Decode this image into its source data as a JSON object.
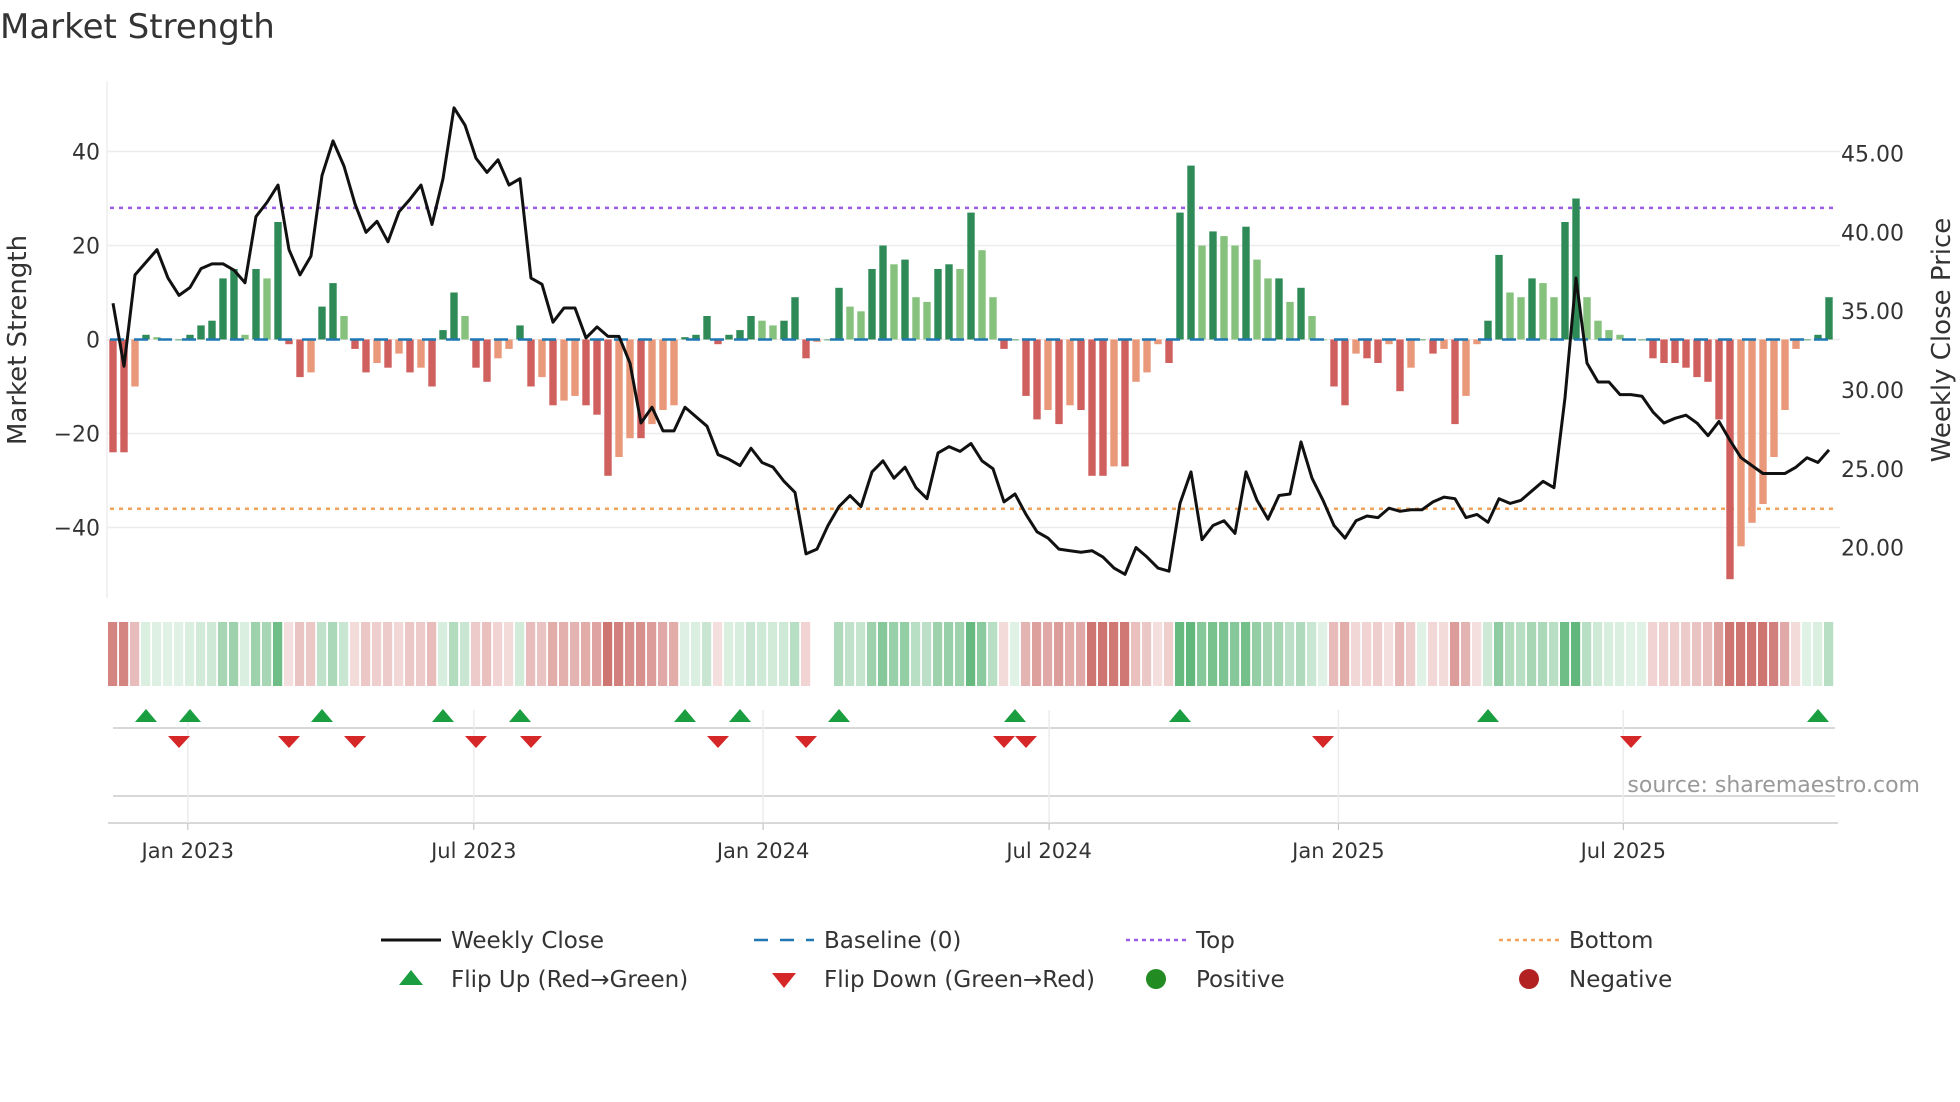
{
  "chart_data": {
    "type": "bar+line",
    "title": "Market Strength",
    "ylabel_left": "Market Strength",
    "ylabel_right": "Weekly Close Price",
    "ylim_left": [
      -55,
      55
    ],
    "ylim_right": [
      16.8,
      49.6
    ],
    "left_ticks": [
      40,
      20,
      0,
      -20,
      -40
    ],
    "left_tick_labels": [
      "40",
      "20",
      "0",
      "−20",
      "−40"
    ],
    "right_ticks": [
      45,
      40,
      35,
      30,
      25,
      20
    ],
    "right_tick_labels": [
      "45.00",
      "40.00",
      "35.00",
      "30.00",
      "25.00",
      "20.00"
    ],
    "x_tick_labels": [
      "Jan 2023",
      "Jul 2023",
      "Jan 2024",
      "Jul 2024",
      "Jan 2025",
      "Jul 2025"
    ],
    "x_tick_week_index": [
      6.8,
      32.8,
      59.1,
      85.1,
      111.4,
      137.3
    ],
    "top_threshold": 28,
    "bottom_threshold": -36,
    "strength": [
      -24,
      -24,
      -10,
      1,
      0.5,
      0,
      0,
      1,
      3,
      4,
      13,
      15,
      1,
      15,
      13,
      25,
      -1,
      -8,
      -7,
      7,
      12,
      5,
      -2,
      -7,
      -5,
      -6,
      -3,
      -7,
      -6,
      -10,
      2,
      10,
      5,
      -6,
      -9,
      -4,
      -2,
      3,
      -10,
      -8,
      -14,
      -13,
      -12,
      -14,
      -16,
      -29,
      -25,
      -21,
      -21,
      -18,
      -15,
      -14,
      0.5,
      1,
      5,
      -1,
      1,
      2,
      5,
      4,
      3,
      4,
      9,
      -4,
      -0.5,
      0,
      11,
      7,
      6,
      15,
      20,
      16,
      17,
      9,
      8,
      15,
      16,
      15,
      27,
      19,
      9,
      -2,
      0,
      -12,
      -17,
      -15,
      -18,
      -14,
      -15,
      -29,
      -29,
      -27,
      -27,
      -9,
      -7,
      -1,
      -5,
      27,
      37,
      20,
      23,
      22,
      20,
      24,
      17,
      13,
      13,
      8,
      11,
      5,
      0,
      -10,
      -14,
      -3,
      -4,
      -5,
      -1,
      -11,
      -6,
      0,
      -3,
      -2,
      -18,
      -12,
      -1,
      4,
      18,
      10,
      9,
      13,
      12,
      9,
      25,
      30,
      9,
      4,
      2,
      1,
      0,
      0,
      -4,
      -5,
      -5,
      -6,
      -8,
      -9,
      -17,
      -51,
      -44,
      -39,
      -35,
      -25,
      -15,
      -2,
      0,
      1,
      9
    ],
    "weekly_close": [
      35.5,
      31.5,
      37.3,
      38.1,
      38.9,
      37.1,
      36,
      36.5,
      37.7,
      38,
      38,
      37.6,
      36.8,
      41,
      41.9,
      43,
      38.9,
      37.3,
      38.5,
      43.6,
      45.8,
      44.2,
      41.8,
      40,
      40.7,
      39.4,
      41.3,
      42.1,
      43,
      40.5,
      43.4,
      47.9,
      46.8,
      44.7,
      43.8,
      44.6,
      43,
      43.4,
      37.1,
      36.7,
      34.3,
      35.2,
      35.2,
      33.3,
      34,
      33.4,
      33.4,
      31.7,
      27.9,
      28.9,
      27.4,
      27.4,
      28.9,
      28.3,
      27.7,
      25.9,
      25.6,
      25.2,
      26.3,
      25.4,
      25.1,
      24.2,
      23.5,
      19.6,
      19.9,
      21.4,
      22.6,
      23.3,
      22.6,
      24.8,
      25.5,
      24.4,
      25.1,
      23.8,
      23.1,
      26,
      26.4,
      26.1,
      26.6,
      25.5,
      25,
      22.9,
      23.4,
      22.1,
      21,
      20.6,
      19.9,
      19.8,
      19.7,
      19.8,
      19.4,
      18.7,
      18.3,
      20,
      19.4,
      18.7,
      18.5,
      22.8,
      24.8,
      20.5,
      21.4,
      21.7,
      20.9,
      24.8,
      23,
      21.8,
      23.3,
      23.4,
      26.7,
      24.4,
      23,
      21.4,
      20.6,
      21.7,
      22,
      21.9,
      22.5,
      22.3,
      22.4,
      22.4,
      22.9,
      23.2,
      23.1,
      21.9,
      22.1,
      21.6,
      23.1,
      22.8,
      23,
      23.6,
      24.2,
      23.8,
      29.5,
      37.1,
      31.7,
      30.5,
      30.5,
      29.7,
      29.7,
      29.6,
      28.6,
      27.9,
      28.2,
      28.4,
      27.9,
      27.1,
      28,
      26.8,
      25.7,
      25.2,
      24.7,
      24.7,
      24.7,
      25.1,
      25.7,
      25.4,
      26.2
    ],
    "flip_up_week_index": [
      3,
      7,
      19,
      30,
      37,
      52,
      57,
      66,
      82,
      97,
      125,
      155
    ],
    "flip_down_week_index": [
      6,
      16,
      22,
      33,
      38,
      55,
      63,
      81,
      83,
      110,
      138
    ],
    "legend_placement": "bottom-center",
    "legend": [
      "Weekly Close",
      "Baseline (0)",
      "Top",
      "Bottom",
      "Flip Up (Red→Green)",
      "Flip Down (Green→Red)",
      "Positive",
      "Negative"
    ],
    "source": "source: sharemaestro.com"
  },
  "colors": {
    "pos_strong": "#2e8b57",
    "pos_weak": "#86c27e",
    "neg_strong": "#d0605e",
    "neg_weak": "#e9987a",
    "line": "#111111",
    "baseline": "#1f77b4",
    "top": "#9b5de5",
    "bottom": "#f4a259",
    "flip_up": "#1a9e3f",
    "flip_down": "#d62728",
    "positive": "#228b22",
    "negative": "#b22222"
  }
}
